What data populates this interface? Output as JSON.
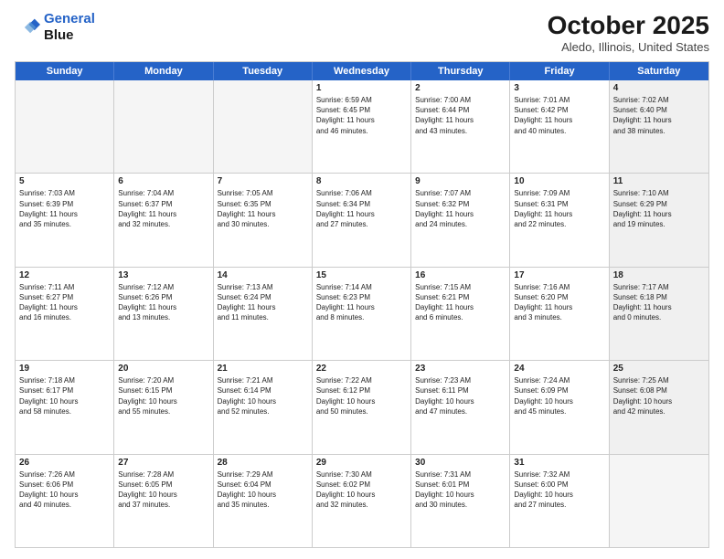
{
  "header": {
    "logo_line1": "General",
    "logo_line2": "Blue",
    "month_year": "October 2025",
    "location": "Aledo, Illinois, United States"
  },
  "weekdays": [
    "Sunday",
    "Monday",
    "Tuesday",
    "Wednesday",
    "Thursday",
    "Friday",
    "Saturday"
  ],
  "rows": [
    [
      {
        "day": "",
        "text": "",
        "empty": true
      },
      {
        "day": "",
        "text": "",
        "empty": true
      },
      {
        "day": "",
        "text": "",
        "empty": true
      },
      {
        "day": "1",
        "text": "Sunrise: 6:59 AM\nSunset: 6:45 PM\nDaylight: 11 hours\nand 46 minutes."
      },
      {
        "day": "2",
        "text": "Sunrise: 7:00 AM\nSunset: 6:44 PM\nDaylight: 11 hours\nand 43 minutes."
      },
      {
        "day": "3",
        "text": "Sunrise: 7:01 AM\nSunset: 6:42 PM\nDaylight: 11 hours\nand 40 minutes."
      },
      {
        "day": "4",
        "text": "Sunrise: 7:02 AM\nSunset: 6:40 PM\nDaylight: 11 hours\nand 38 minutes.",
        "shaded": true
      }
    ],
    [
      {
        "day": "5",
        "text": "Sunrise: 7:03 AM\nSunset: 6:39 PM\nDaylight: 11 hours\nand 35 minutes."
      },
      {
        "day": "6",
        "text": "Sunrise: 7:04 AM\nSunset: 6:37 PM\nDaylight: 11 hours\nand 32 minutes."
      },
      {
        "day": "7",
        "text": "Sunrise: 7:05 AM\nSunset: 6:35 PM\nDaylight: 11 hours\nand 30 minutes."
      },
      {
        "day": "8",
        "text": "Sunrise: 7:06 AM\nSunset: 6:34 PM\nDaylight: 11 hours\nand 27 minutes."
      },
      {
        "day": "9",
        "text": "Sunrise: 7:07 AM\nSunset: 6:32 PM\nDaylight: 11 hours\nand 24 minutes."
      },
      {
        "day": "10",
        "text": "Sunrise: 7:09 AM\nSunset: 6:31 PM\nDaylight: 11 hours\nand 22 minutes."
      },
      {
        "day": "11",
        "text": "Sunrise: 7:10 AM\nSunset: 6:29 PM\nDaylight: 11 hours\nand 19 minutes.",
        "shaded": true
      }
    ],
    [
      {
        "day": "12",
        "text": "Sunrise: 7:11 AM\nSunset: 6:27 PM\nDaylight: 11 hours\nand 16 minutes."
      },
      {
        "day": "13",
        "text": "Sunrise: 7:12 AM\nSunset: 6:26 PM\nDaylight: 11 hours\nand 13 minutes."
      },
      {
        "day": "14",
        "text": "Sunrise: 7:13 AM\nSunset: 6:24 PM\nDaylight: 11 hours\nand 11 minutes."
      },
      {
        "day": "15",
        "text": "Sunrise: 7:14 AM\nSunset: 6:23 PM\nDaylight: 11 hours\nand 8 minutes."
      },
      {
        "day": "16",
        "text": "Sunrise: 7:15 AM\nSunset: 6:21 PM\nDaylight: 11 hours\nand 6 minutes."
      },
      {
        "day": "17",
        "text": "Sunrise: 7:16 AM\nSunset: 6:20 PM\nDaylight: 11 hours\nand 3 minutes."
      },
      {
        "day": "18",
        "text": "Sunrise: 7:17 AM\nSunset: 6:18 PM\nDaylight: 11 hours\nand 0 minutes.",
        "shaded": true
      }
    ],
    [
      {
        "day": "19",
        "text": "Sunrise: 7:18 AM\nSunset: 6:17 PM\nDaylight: 10 hours\nand 58 minutes."
      },
      {
        "day": "20",
        "text": "Sunrise: 7:20 AM\nSunset: 6:15 PM\nDaylight: 10 hours\nand 55 minutes."
      },
      {
        "day": "21",
        "text": "Sunrise: 7:21 AM\nSunset: 6:14 PM\nDaylight: 10 hours\nand 52 minutes."
      },
      {
        "day": "22",
        "text": "Sunrise: 7:22 AM\nSunset: 6:12 PM\nDaylight: 10 hours\nand 50 minutes."
      },
      {
        "day": "23",
        "text": "Sunrise: 7:23 AM\nSunset: 6:11 PM\nDaylight: 10 hours\nand 47 minutes."
      },
      {
        "day": "24",
        "text": "Sunrise: 7:24 AM\nSunset: 6:09 PM\nDaylight: 10 hours\nand 45 minutes."
      },
      {
        "day": "25",
        "text": "Sunrise: 7:25 AM\nSunset: 6:08 PM\nDaylight: 10 hours\nand 42 minutes.",
        "shaded": true
      }
    ],
    [
      {
        "day": "26",
        "text": "Sunrise: 7:26 AM\nSunset: 6:06 PM\nDaylight: 10 hours\nand 40 minutes."
      },
      {
        "day": "27",
        "text": "Sunrise: 7:28 AM\nSunset: 6:05 PM\nDaylight: 10 hours\nand 37 minutes."
      },
      {
        "day": "28",
        "text": "Sunrise: 7:29 AM\nSunset: 6:04 PM\nDaylight: 10 hours\nand 35 minutes."
      },
      {
        "day": "29",
        "text": "Sunrise: 7:30 AM\nSunset: 6:02 PM\nDaylight: 10 hours\nand 32 minutes."
      },
      {
        "day": "30",
        "text": "Sunrise: 7:31 AM\nSunset: 6:01 PM\nDaylight: 10 hours\nand 30 minutes."
      },
      {
        "day": "31",
        "text": "Sunrise: 7:32 AM\nSunset: 6:00 PM\nDaylight: 10 hours\nand 27 minutes."
      },
      {
        "day": "",
        "text": "",
        "empty": true,
        "shaded": true
      }
    ]
  ]
}
